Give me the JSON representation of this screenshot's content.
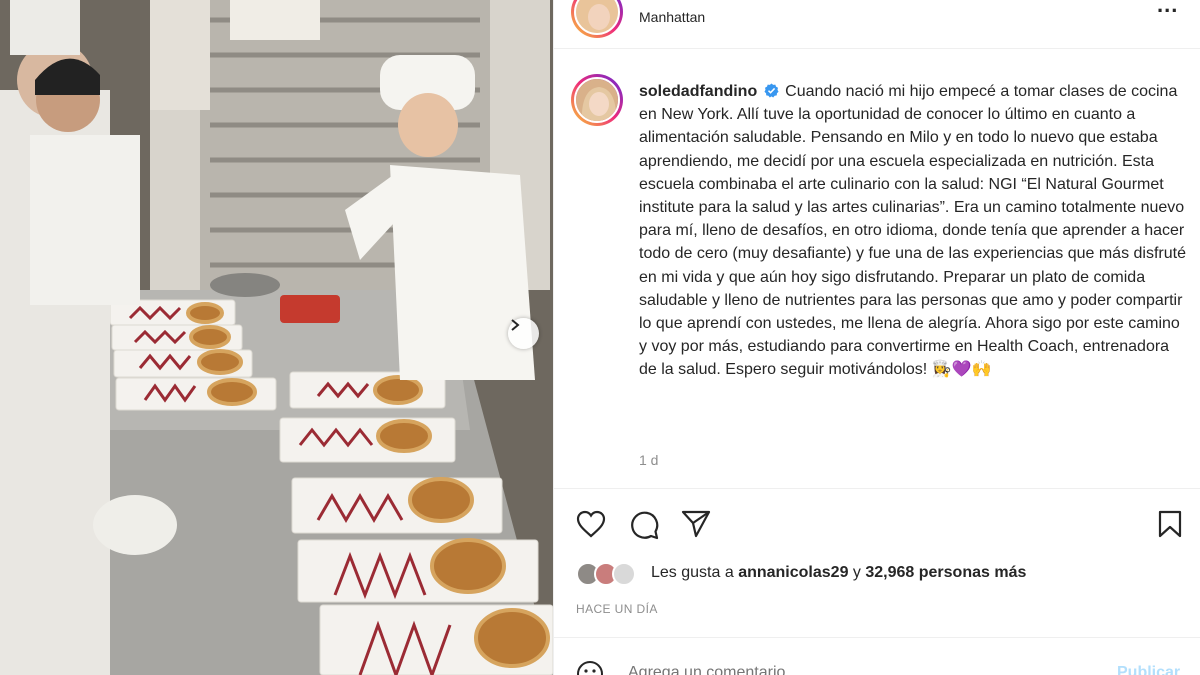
{
  "post": {
    "location": "Manhattan",
    "username": "soledadfandino",
    "caption": "Cuando nació mi hijo empecé a tomar clases de cocina en New York. Allí tuve la oportunidad de conocer lo último en cuanto a alimentación saludable. Pensando en Milo y en todo lo nuevo que estaba aprendiendo, me decidí por una escuela especializada en nutrición. Esta escuela combinaba el arte culinario con la salud: NGI “El Natural Gourmet institute para la salud y las artes culinarias”. Era un camino totalmente nuevo para mí, lleno de desafíos, en otro idioma, donde tenía que aprender a hacer todo de cero (muy desafiante) y fue una de las experiencias que más disfruté en mi vida y que aún hoy sigo disfrutando. Preparar un plato de comida saludable y lleno de nutrientes para las personas que amo y poder compartir lo que aprendí con ustedes, me llena de alegría. Ahora sigo por este camino y voy por más, estudiando para convertirme en Health Coach, entrenadora de la salud. Espero seguir motivándolos! 👩‍🍳💜🙌",
    "caption_time": "1 d",
    "likes_prefix": "Les gusta a",
    "likes_user": "annanicolas29",
    "likes_middle": "y",
    "likes_count": "32,968 personas más",
    "posted_ago": "HACE UN DÍA",
    "comment_placeholder": "Agrega un comentario...",
    "publish_label": "Publicar"
  },
  "icons": [
    "heart-icon",
    "comment-icon",
    "share-icon",
    "bookmark-icon",
    "more-icon",
    "verified-icon",
    "chevron-right-icon",
    "emoji-icon"
  ],
  "colors": {
    "verified": "#3897f0",
    "publish": "#b2dffc",
    "secondary_text": "#8e8e8e"
  }
}
